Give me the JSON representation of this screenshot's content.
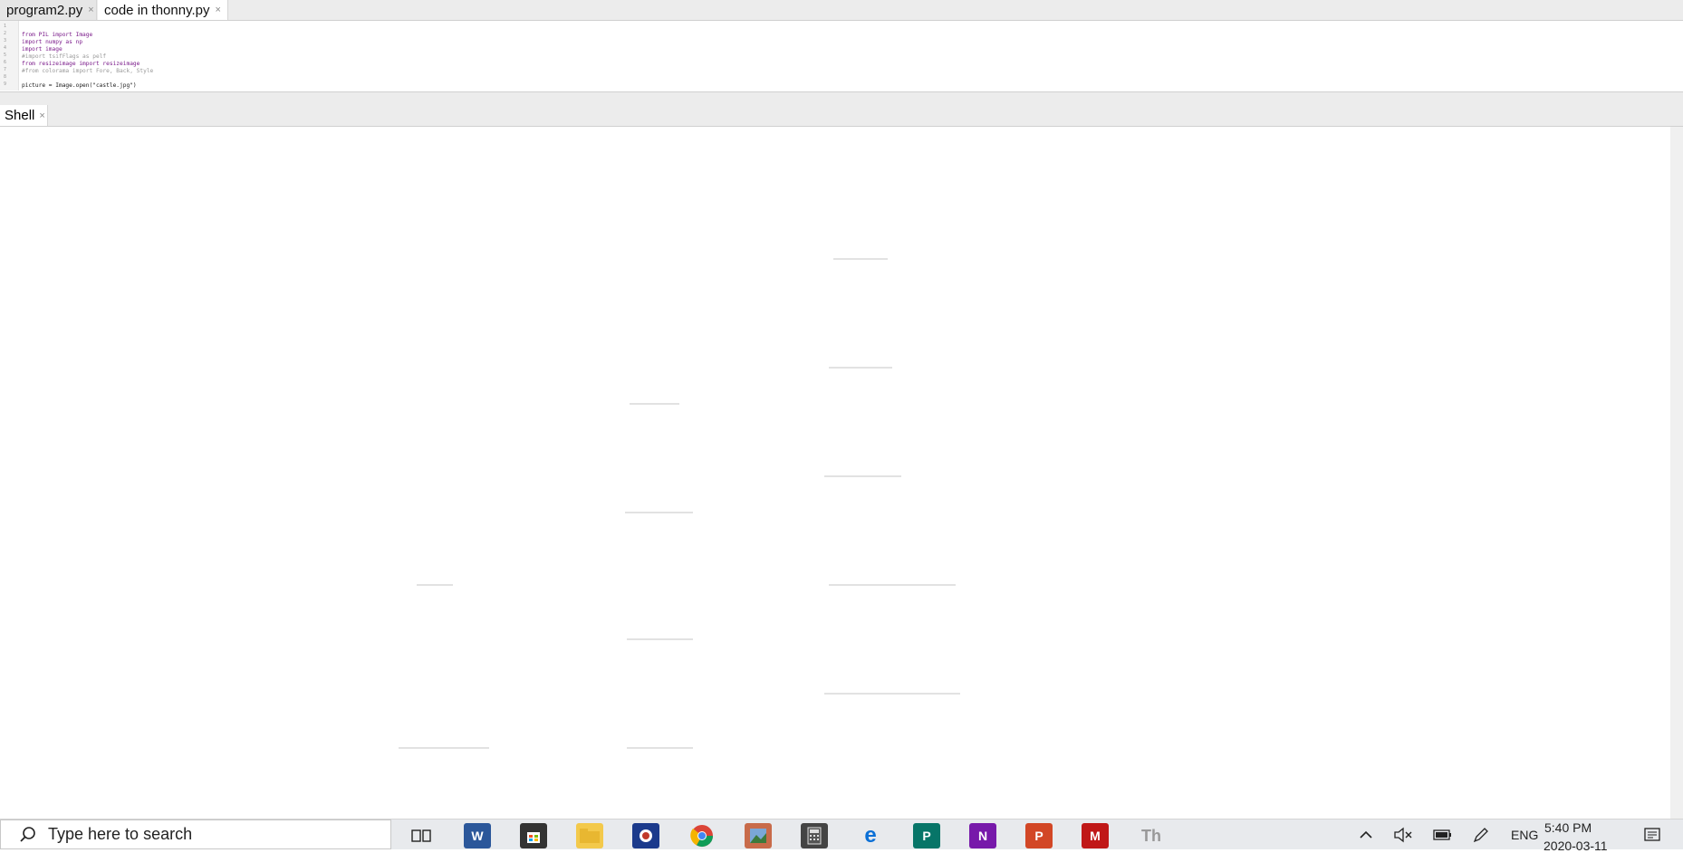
{
  "editor": {
    "tabs": [
      {
        "label": "program2.py",
        "close": "×"
      },
      {
        "label": "code in thonny.py",
        "close": "×"
      }
    ],
    "line_numbers": [
      "1",
      "2",
      "3",
      "4",
      "5",
      "6",
      "7",
      "8",
      "9"
    ],
    "lines": [
      "from PIL import Image",
      "import numpy as np",
      "import image",
      "#import tsifFlags as pelf",
      "from resizeimage import resizeimage",
      "#from colorama import Fore, Back, Style",
      "",
      "picture = Image.open(\"castle.jpg\")"
    ]
  },
  "shell": {
    "tab_label": "Shell",
    "tab_close": "×",
    "ascii_fill_char": "$",
    "colors": {
      "ascii_ink": "#9a9a9a",
      "background": "#ffffff"
    }
  },
  "taskbar": {
    "search_placeholder": "Type here to search",
    "apps": [
      "task-view",
      "word",
      "store",
      "file-explorer",
      "app-blue",
      "chrome",
      "photos",
      "calculator",
      "edge",
      "publisher",
      "onenote",
      "powerpoint",
      "mcafee",
      "thonny"
    ],
    "tray": {
      "language": "ENG",
      "time": "5:40 PM",
      "date": "2020-03-11"
    }
  }
}
